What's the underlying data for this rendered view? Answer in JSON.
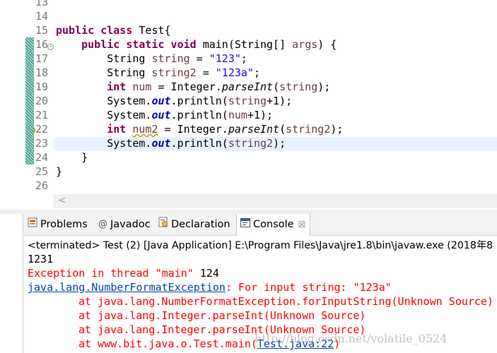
{
  "editor": {
    "lines": [
      {
        "n": "13",
        "html": ""
      },
      {
        "n": "14",
        "html": ""
      },
      {
        "n": "15",
        "html": "<span class=\"kw\">public class</span> Test{"
      },
      {
        "n": "16",
        "html": "    <span class=\"kw\">public static void</span> main(String[] <span class=\"var\">args</span>) {"
      },
      {
        "n": "17",
        "html": "        String <span class=\"var\">string</span> = <span class=\"str\">\"123\"</span>;"
      },
      {
        "n": "18",
        "html": "        String <span class=\"var\">string2</span> = <span class=\"str\">\"123a\"</span>;"
      },
      {
        "n": "19",
        "html": "        <span class=\"kw\">int</span> <span class=\"var\">num</span> = Integer.<span class=\"itl\">parseInt</span>(<span class=\"var\">string</span>);"
      },
      {
        "n": "20",
        "html": "        System.<span class=\"fld\">out</span>.println(<span class=\"var\">string</span>+1);"
      },
      {
        "n": "21",
        "html": "        System.<span class=\"fld\">out</span>.println(<span class=\"var\">num</span>+1);"
      },
      {
        "n": "22",
        "html": "        <span class=\"kw\">int</span> <span class=\"var warn-ul\">num2</span> = Integer.<span class=\"itl\">parseInt</span>(<span class=\"var\">string2</span>);"
      },
      {
        "n": "23",
        "html": "        System.<span class=\"fld\">out</span>.println(<span class=\"var\">string2</span>);"
      },
      {
        "n": "24",
        "html": "    }"
      },
      {
        "n": "25",
        "html": "}"
      },
      {
        "n": "26",
        "html": ""
      }
    ],
    "hscroll_arrow": "<"
  },
  "tabs": [
    {
      "label": "Problems",
      "icon": "problems-icon"
    },
    {
      "label": "Javadoc",
      "icon": "javadoc-icon",
      "prefix": "@"
    },
    {
      "label": "Declaration",
      "icon": "declaration-icon"
    },
    {
      "label": "Console",
      "icon": "console-icon",
      "active": true,
      "close": "☒"
    }
  ],
  "console": {
    "terminated": "<terminated> Test (2) [Java Application] E:\\Program Files\\Java\\jre1.8\\bin\\javaw.exe (2018年8",
    "out_line": "1231",
    "exception_prefix": "Exception in thread \"main\" ",
    "exception_value": "124",
    "nfe_class": "java.lang.NumberFormatException",
    "nfe_msg": ": For input string: \"123a\"",
    "trace": [
      "at java.lang.NumberFormatException.forInputString(Unknown Source)",
      "at java.lang.Integer.parseInt(Unknown Source)",
      "at java.lang.Integer.parseInt(Unknown Source)"
    ],
    "last_prefix": "at www.bit.java.o.Test.main(",
    "last_link": "Test.java:22",
    "last_suffix": ")"
  },
  "watermark": "http://blog.csdn.net/volatile_0524",
  "colors": {
    "keyword": "#7f0055",
    "string": "#2a00ff",
    "error": "#ff0000",
    "link": "#0645ad",
    "highlight": "#e8f2fe"
  }
}
